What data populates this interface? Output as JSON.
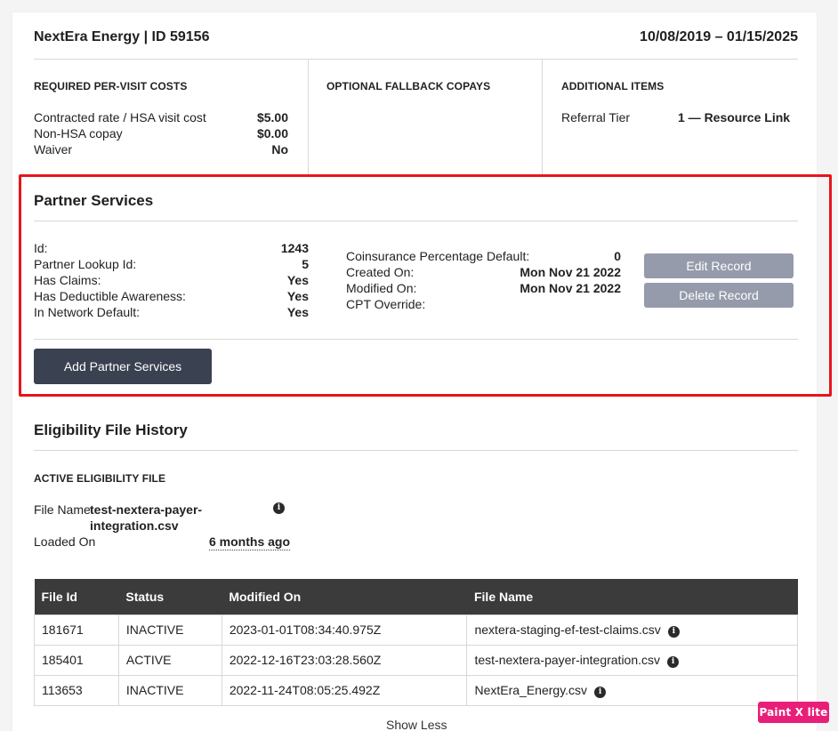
{
  "header": {
    "company": "NextEra Energy | ID 59156",
    "date_range": "10/08/2019 – 01/15/2025"
  },
  "costs": {
    "required_title": "REQUIRED PER-VISIT COSTS",
    "optional_title": "OPTIONAL FALLBACK COPAYS",
    "additional_title": "ADDITIONAL ITEMS",
    "rows": [
      {
        "label": "Contracted rate / HSA visit cost",
        "value": "$5.00"
      },
      {
        "label": "Non-HSA copay",
        "value": "$0.00"
      },
      {
        "label": "Waiver",
        "value": "No"
      }
    ],
    "referral_label": "Referral Tier",
    "referral_value": "1 — Resource Link"
  },
  "partner": {
    "title": "Partner Services",
    "left_rows": [
      {
        "label": "Id:",
        "value": "1243"
      },
      {
        "label": "Partner Lookup Id:",
        "value": "5"
      },
      {
        "label": "Has Claims:",
        "value": "Yes"
      },
      {
        "label": "Has Deductible Awareness:",
        "value": "Yes"
      },
      {
        "label": "In Network Default:",
        "value": "Yes"
      }
    ],
    "right_rows": [
      {
        "label": "Coinsurance Percentage Default:",
        "value": "0"
      },
      {
        "label": "Created On:",
        "value": "Mon Nov 21 2022"
      },
      {
        "label": "Modified On:",
        "value": "Mon Nov 21 2022"
      },
      {
        "label": "CPT Override:",
        "value": ""
      }
    ],
    "edit_label": "Edit Record",
    "delete_label": "Delete Record",
    "add_label": "Add Partner Services"
  },
  "eligibility": {
    "title": "Eligibility File History",
    "active_title": "ACTIVE ELIGIBILITY FILE",
    "file_name_label": "File Name",
    "file_name_line1": "test-nextera-payer-",
    "file_name_line2": "integration.csv",
    "loaded_label": "Loaded On",
    "loaded_value": "6 months ago",
    "table": {
      "headers": [
        "File Id",
        "Status",
        "Modified On",
        "File Name"
      ],
      "rows": [
        [
          "181671",
          "INACTIVE",
          "2023-01-01T08:34:40.975Z",
          "nextera-staging-ef-test-claims.csv"
        ],
        [
          "185401",
          "ACTIVE",
          "2022-12-16T23:03:28.560Z",
          "test-nextera-payer-integration.csv"
        ],
        [
          "113653",
          "INACTIVE",
          "2022-11-24T08:05:25.492Z",
          "NextEra_Energy.csv"
        ]
      ]
    },
    "show_less": "Show Less"
  },
  "icons": {
    "info": "info-icon",
    "info_glyph": "i"
  },
  "badge": "Paint X lite",
  "colors": {
    "highlight": "#e8141c",
    "dark_button": "#3a4150",
    "grey_button": "#959bab",
    "table_header": "#3b3b3b",
    "badge": "#e91e78"
  }
}
